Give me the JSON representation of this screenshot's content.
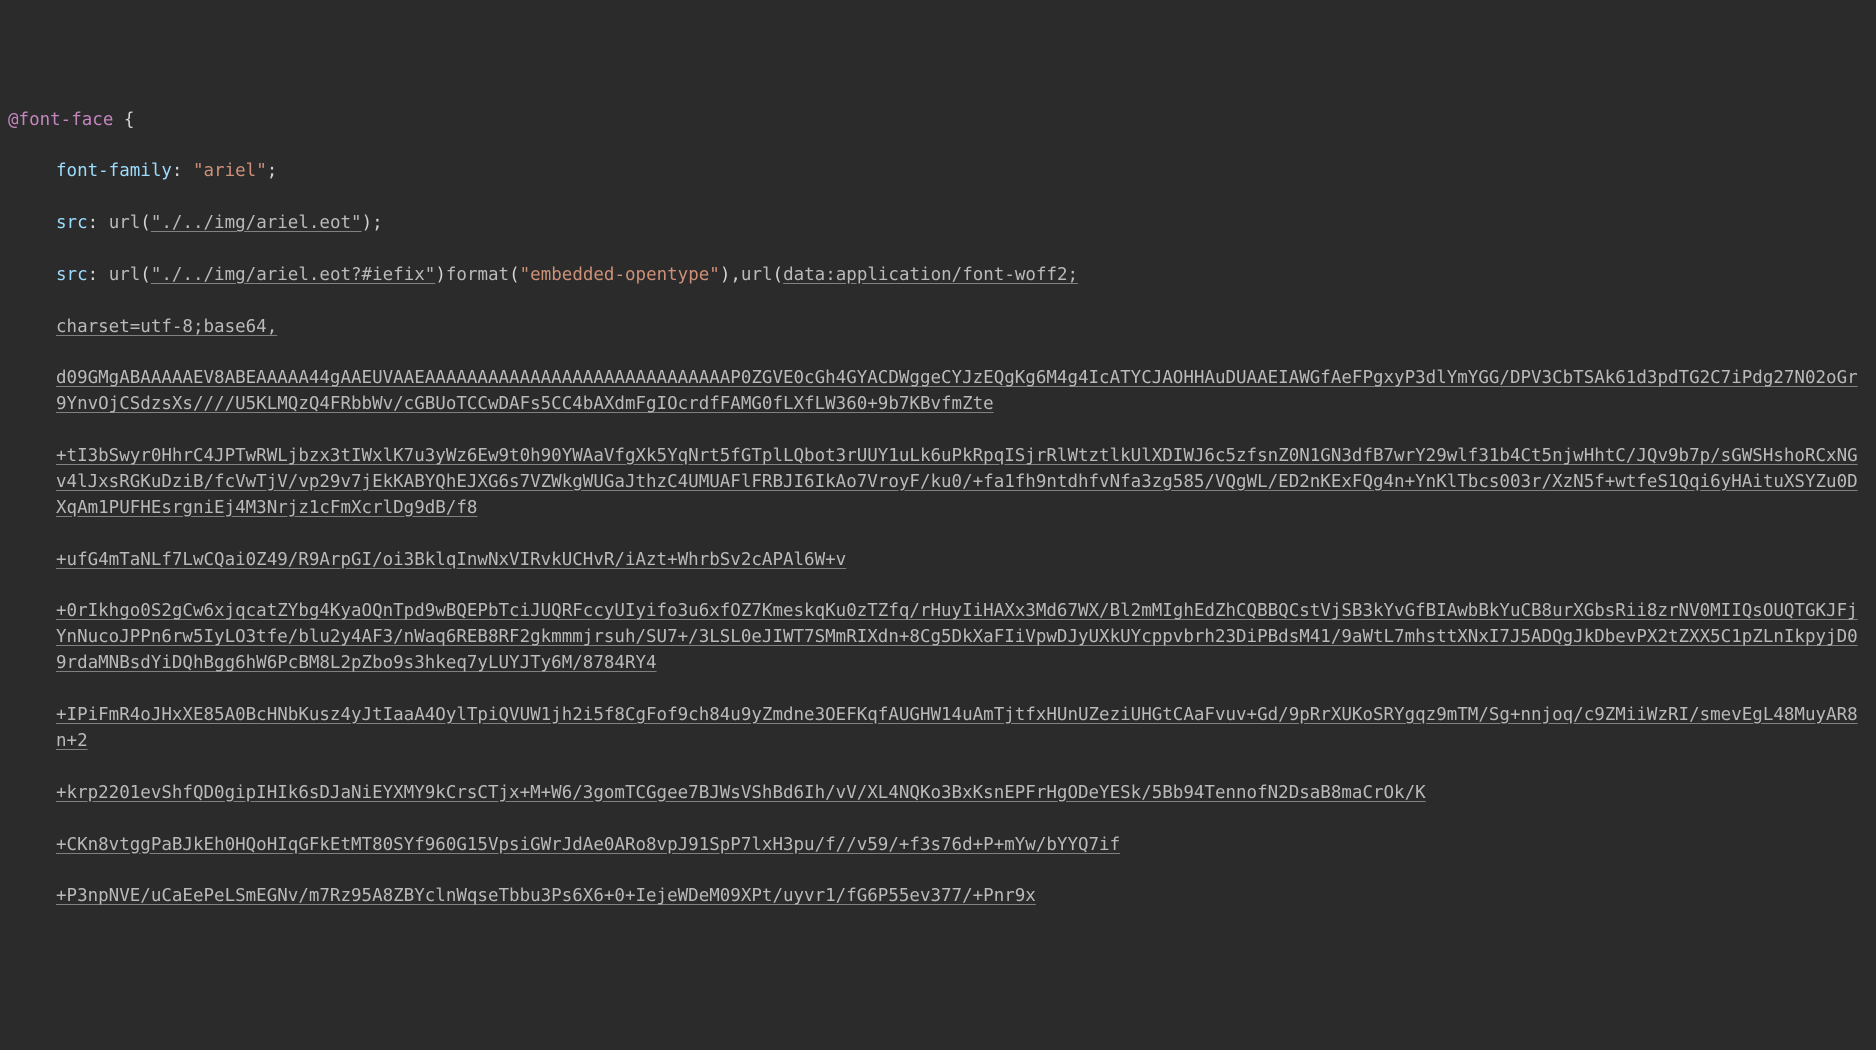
{
  "code": {
    "atRule": "@font-face",
    "brace_open": " {",
    "line1_prop": "font-family",
    "line1_val": "\"ariel\"",
    "line2_prop": "src",
    "line2_url_func": "url",
    "line2_url_content": "\"./../img/ariel.eot\"",
    "line3_prop": "src",
    "line3_url_func": "url",
    "line3_url_content": "\"./../img/ariel.eot?#iefix\"",
    "line3_format_func": "format",
    "line3_format_val": "\"embedded-opentype\"",
    "line3_url2_func": "url",
    "line3_url2_prefix": "data:application/font-woff2;",
    "wrap1": "charset=utf-8;base64,",
    "wrap2": "d09GMgABAAAAAEV8ABEAAAAA44gAAEUVAAEAAAAAAAAAAAAAAAAAAAAAAAAAAAAAP0ZGVE0cGh4GYACDWggeCYJzEQgKg6M4g4IcATYCJAOHHAuDUAAEIAWGfAeFPgxyP3dlYmYGG/DPV3CbTSAk61d3pdTG2C7iPdg27N02oGr9YnvOjCSdzsXs////U5KLMQzQ4FRbbWv/cGBUoTCCwDAFs5CC4bAXdmFgIOcrdfFAMG0fLXfLW360+9b7KBvfmZte",
    "wrap3": "+tI3bSwyr0HhrC4JPTwRWLjbzx3tIWxlK7u3yWz6Ew9t0h90YWAaVfgXk5YqNrt5fGTplLQbot3rUUY1uLk6uPkRpqISjrRlWtztlkUlXDIWJ6c5zfsnZ0N1GN3dfB7wrY29wlf31b4Ct5njwHhtC/JQv9b7p/sGWSHshoRCxNGv4lJxsRGKuDziB/fcVwTjV/vp29v7jEkKABYQhEJXG6s7VZWkgWUGaJthzC4UMUAFlFRBJI6IkAo7VroyF/ku0/+fa1fh9ntdhfvNfa3zg585/VQgWL/ED2nKExFQg4n+YnKlTbcs003r/XzN5f+wtfeS1Qqi6yHAituXSYZu0DXqAm1PUFHEsrgniEj4M3Nrjz1cFmXcrlDg9dB/f8",
    "wrap4": "+ufG4mTaNLf7LwCQai0Z49/R9ArpGI/oi3BklqInwNxVIRvkUCHvR/iAzt+WhrbSv2cAPAl6W+v",
    "wrap5": "+0rIkhgo0S2gCw6xjqcatZYbg4KyaOQnTpd9wBQEPbTciJUQRFccyUIyifo3u6xfOZ7KmeskqKu0zTZfq/rHuyIiHAXx3Md67WX/Bl2mMIghEdZhCQBBQCstVjSB3kYvGfBIAwbBkYuCB8urXGbsRii8zrNV0MIIQsOUQTGKJFjYnNucoJPPn6rw5IyLO3tfe/blu2y4AF3/nWaq6REB8RF2gkmmmjrsuh/SU7+/3LSL0eJIWT7SMmRIXdn+8Cg5DkXaFIiVpwDJyUXkUYcppvbrh23DiPBdsM41/9aWtL7mhsttXNxI7J5ADQgJkDbevPX2tZXX5C1pZLnIkpyjD09rdaMNBsdYiDQhBgg6hW6PcBM8L2pZbo9s3hkeq7yLUYJTy6M/8784RY4",
    "wrap6": "+IPiFmR4oJHxXE85A0BcHNbKusz4yJtIaaA4OylTpiQVUW1jh2i5f8CgFof9ch84u9yZmdne3OEFKqfAUGHW14uAmTjtfxHUnUZeziUHGtCAaFvuv+Gd/9pRrXUKoSRYgqz9mTM/Sg+nnjoq/c9ZMiiWzRI/smevEgL48MuyAR8n+2",
    "wrap7": "+krp2201evShfQD0gipIHIk6sDJaNiEYXMY9kCrsCTjx+M+W6/3gomTCGgee7BJWsVShBd6Ih/vV/XL4NQKo3BxKsnEPFrHgODeYESk/5Bb94TennofN2DsaB8maCrOk/K",
    "wrap8": "+CKn8vtggPaBJkEh0HQoHIqGFkEtMT80SYf960G15VpsiGWrJdAe0ARo8vpJ91SpP7lxH3pu/f//v59/+f3s76d+P+mYw/bYYQ7if",
    "wrap9": "+P3npNVE/uCaEePeLSmEGNv/m7Rz95A8ZBYclnWqseTbbu3Ps6X6+0+IejeWDeM09XPt/uyvr1/fG6P55ev377/+Pnr9x"
  }
}
